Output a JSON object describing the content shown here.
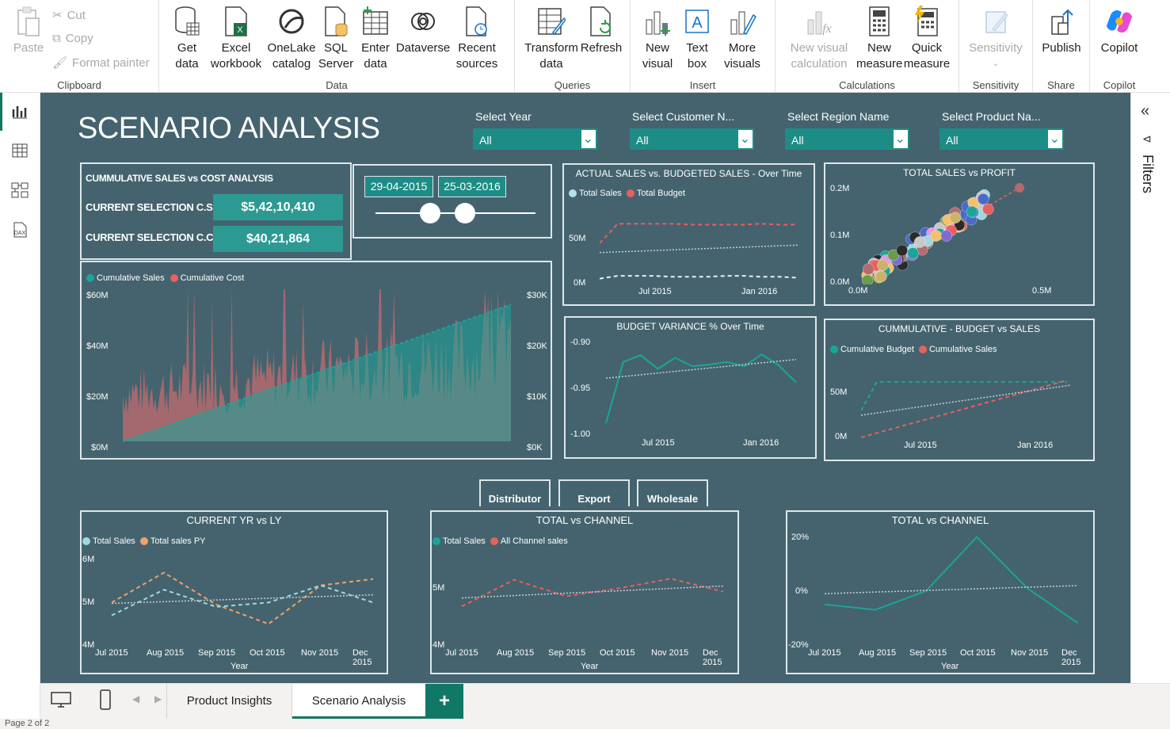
{
  "ribbon": {
    "clipboard": {
      "paste": "Paste",
      "cut": "Cut",
      "copy": "Copy",
      "format_painter": "Format painter",
      "label": "Clipboard"
    },
    "data": {
      "get_data": "Get\ndata",
      "excel": "Excel\nworkbook",
      "onelake": "OneLake\ncatalog",
      "sql": "SQL\nServer",
      "enter": "Enter\ndata",
      "dataverse": "Dataverse",
      "recent": "Recent\nsources",
      "label": "Data"
    },
    "queries": {
      "transform": "Transform\ndata",
      "refresh": "Refresh",
      "label": "Queries"
    },
    "insert": {
      "new_visual": "New\nvisual",
      "text_box": "Text\nbox",
      "more_visuals": "More\nvisuals",
      "label": "Insert"
    },
    "calculations": {
      "new_visual_calc": "New visual\ncalculation",
      "new_measure": "New\nmeasure",
      "quick_measure": "Quick\nmeasure",
      "label": "Calculations"
    },
    "sensitivity": {
      "sensitivity": "Sensitivity",
      "label": "Sensitivity"
    },
    "share": {
      "publish": "Publish",
      "label": "Share"
    },
    "copilot": {
      "copilot": "Copilot",
      "label": "Copilot"
    }
  },
  "filters_label": "Filters",
  "report": {
    "title": "SCENARIO ANALYSIS",
    "slicers": [
      {
        "label": "Select Year",
        "value": "All"
      },
      {
        "label": "Select Customer N...",
        "value": "All"
      },
      {
        "label": "Select Region Name",
        "value": "All"
      },
      {
        "label": "Select Product Na...",
        "value": "All"
      }
    ],
    "kpi": {
      "title": "CUMMULATIVE SALES vs COST ANALYSIS",
      "cs_label": "CURRENT SELECTION C.S.",
      "cs_value": "$5,42,10,410",
      "cc_label": "CURRENT SELECTION C.C",
      "cc_value": "$40,21,864"
    },
    "date_range": {
      "start": "29-04-2015",
      "end": "25-03-2016",
      "start_pos": 0.34,
      "end_pos": 0.56
    },
    "channel_buttons": [
      "Distributor",
      "Export",
      "Wholesale"
    ]
  },
  "chart_data": [
    {
      "id": "cumulative",
      "type": "area",
      "legend": [
        "Cumulative Sales",
        "Cumulative Cost"
      ],
      "colors": [
        "#1aa59a",
        "#b46a6f"
      ],
      "y_ticks": [
        "$60M",
        "$40M",
        "$20M",
        "$0M"
      ],
      "y2_ticks": [
        "$30K",
        "$20K",
        "$10K",
        "$0K"
      ],
      "ylim": [
        0,
        60
      ],
      "y2lim": [
        0,
        30
      ],
      "sales_end": 54,
      "cost_peak": 30
    },
    {
      "id": "actual_vs_budget",
      "type": "line",
      "title": "ACTUAL SALES vs. BUDGETED SALES - Over Time",
      "legend": [
        "Total Sales",
        "Total Budget"
      ],
      "colors": [
        "#aee3ea",
        "#e8605f"
      ],
      "y_ticks": [
        "50M",
        "0M"
      ],
      "x_ticks": [
        "Jul 2015",
        "Jan 2016"
      ],
      "budget": [
        40,
        61,
        61,
        61,
        61,
        60,
        60,
        60,
        60,
        61,
        60,
        60
      ],
      "sales": [
        2,
        5,
        5,
        5,
        4,
        4,
        4,
        5,
        5,
        4,
        4,
        3
      ]
    },
    {
      "id": "sales_vs_profit",
      "type": "scatter",
      "title": "TOTAL SALES vs PROFIT",
      "y_ticks": [
        "0.2M",
        "0.1M",
        "0.0M"
      ],
      "x_ticks": [
        "0.0M",
        "0.5M"
      ]
    },
    {
      "id": "budget_variance",
      "type": "line",
      "title": "BUDGET VARIANCE % Over Time",
      "y_ticks": [
        "-0.90",
        "-0.95",
        "-1.00"
      ],
      "x_ticks": [
        "Jul 2015",
        "Jan 2016"
      ],
      "values": [
        -0.993,
        -0.921,
        -0.913,
        -0.929,
        -0.916,
        -0.926,
        -0.924,
        -0.921,
        -0.926,
        -0.912,
        -0.925,
        -0.945
      ]
    },
    {
      "id": "cum_budget_vs_sales",
      "type": "line",
      "title": "CUMMULATIVE - BUDGET vs SALES",
      "legend": [
        "Cumulative Budget",
        "Cumulative Sales"
      ],
      "colors": [
        "#1aa59a",
        "#e8605f"
      ],
      "y_ticks": [
        "50M",
        "0M"
      ],
      "x_ticks": [
        "Jul 2015",
        "Jan 2016"
      ]
    },
    {
      "id": "cy_vs_ly",
      "type": "line",
      "title": "CURRENT YR vs LY",
      "legend": [
        "Total Sales",
        "Total sales PY"
      ],
      "colors": [
        "#9fd9e0",
        "#f0a26b"
      ],
      "y_ticks": [
        "6M",
        "5M",
        "4M"
      ],
      "x_ticks": [
        "Jul 2015",
        "Aug 2015",
        "Sep 2015",
        "Oct 2015",
        "Nov 2015",
        "Dec 2015"
      ],
      "xlabel": "Year",
      "sales": [
        4.6,
        5.2,
        4.8,
        4.9,
        5.3,
        4.9
      ],
      "py": [
        4.9,
        5.6,
        4.85,
        4.4,
        5.3,
        5.45
      ]
    },
    {
      "id": "total_vs_channel",
      "type": "line",
      "title": "TOTAL vs CHANNEL",
      "legend": [
        "Total Sales",
        "All Channel sales"
      ],
      "colors": [
        "#1aa59a",
        "#e8605f"
      ],
      "y_ticks": [
        "5M",
        "4M"
      ],
      "x_ticks": [
        "Jul 2015",
        "Aug 2015",
        "Sep 2015",
        "Oct 2015",
        "Nov 2015",
        "Dec 2015"
      ],
      "xlabel": "Year",
      "channel": [
        4.5,
        4.97,
        4.68,
        4.82,
        4.99,
        4.76
      ]
    },
    {
      "id": "total_vs_channel_pct",
      "type": "line",
      "title": "TOTAL vs CHANNEL",
      "y_ticks": [
        "20%",
        "0%",
        "-20%"
      ],
      "x_ticks": [
        "Jul 2015",
        "Aug 2015",
        "Sep 2015",
        "Oct 2015",
        "Nov 2015",
        "Dec 2015"
      ],
      "xlabel": "Year",
      "values": [
        -7,
        -9,
        -2,
        18,
        -1,
        -14
      ]
    }
  ],
  "tabs": {
    "page1": "Product Insights",
    "page2": "Scenario Analysis",
    "add": "+"
  },
  "status": "Page 2 of 2"
}
